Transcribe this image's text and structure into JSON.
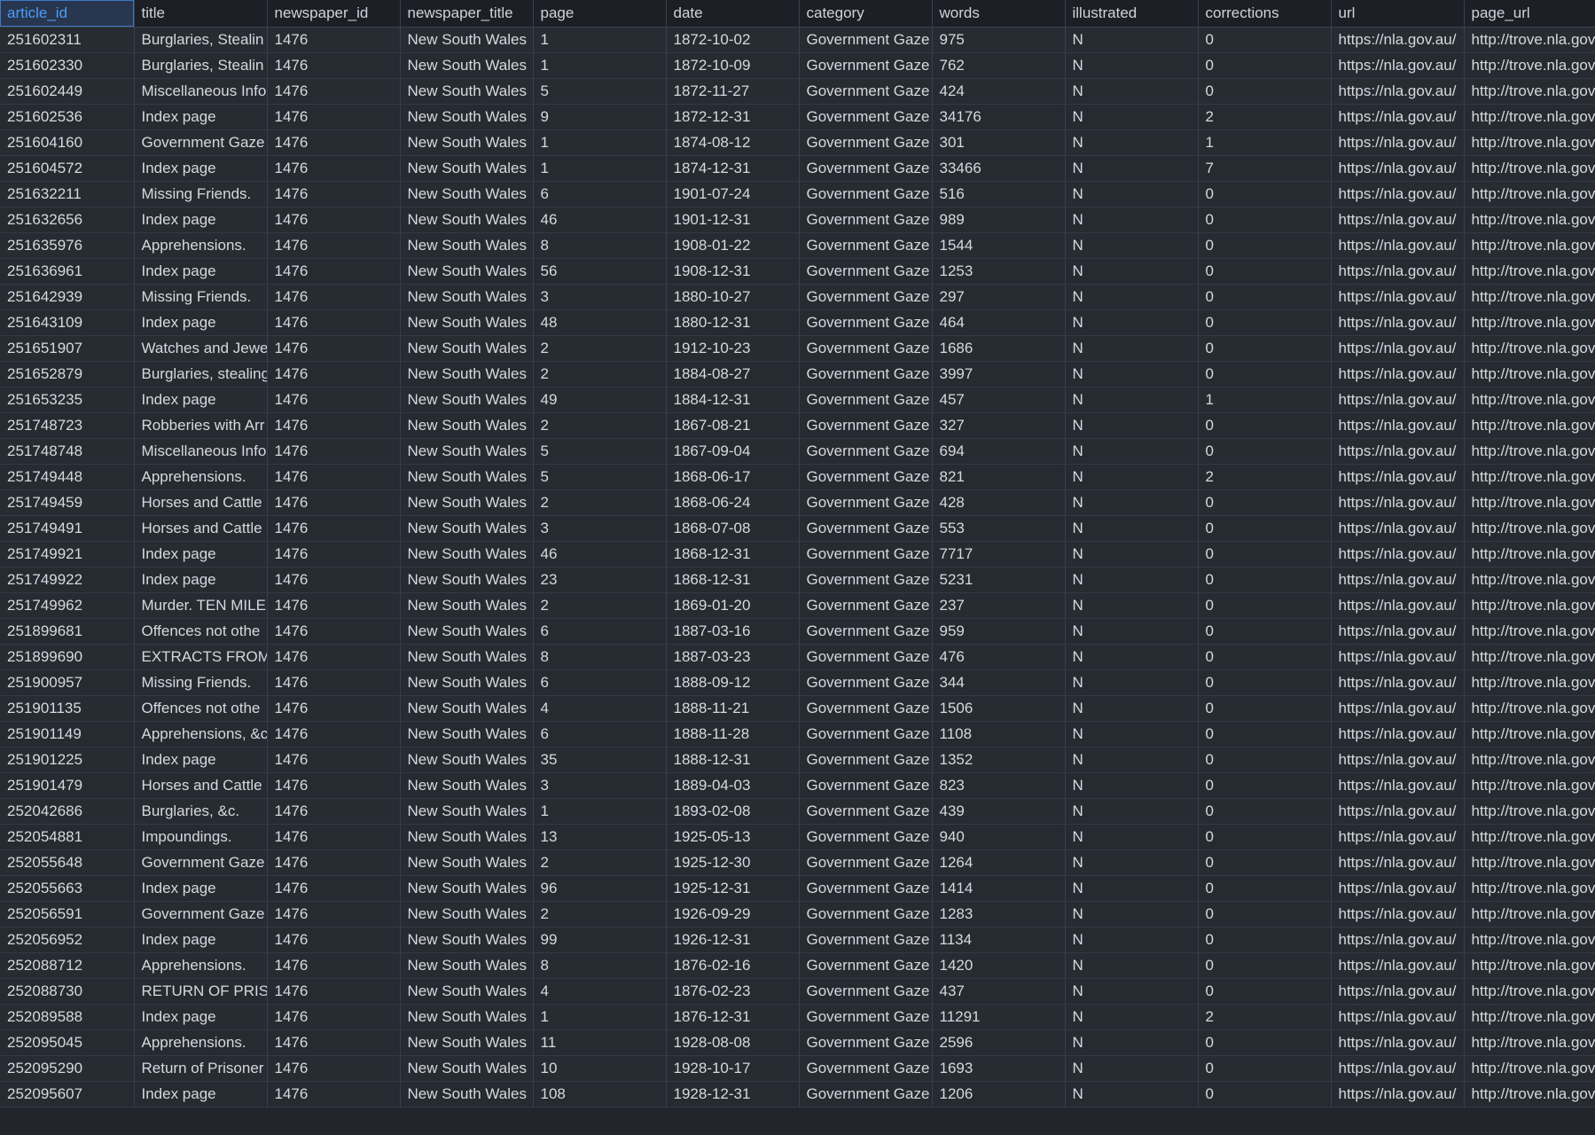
{
  "columns": [
    "article_id",
    "title",
    "newspaper_id",
    "newspaper_title",
    "page",
    "date",
    "category",
    "words",
    "illustrated",
    "corrections",
    "url",
    "page_url"
  ],
  "selected_column": 0,
  "rows": [
    [
      "251602311",
      "Burglaries, Stealin",
      "1476",
      "New South Wales",
      "1",
      "1872-10-02",
      "Government Gaze",
      "975",
      "N",
      "0",
      "https://nla.gov.au/",
      "http://trove.nla.gov"
    ],
    [
      "251602330",
      "Burglaries, Stealin",
      "1476",
      "New South Wales",
      "1",
      "1872-10-09",
      "Government Gaze",
      "762",
      "N",
      "0",
      "https://nla.gov.au/",
      "http://trove.nla.gov"
    ],
    [
      "251602449",
      "Miscellaneous Info",
      "1476",
      "New South Wales",
      "5",
      "1872-11-27",
      "Government Gaze",
      "424",
      "N",
      "0",
      "https://nla.gov.au/",
      "http://trove.nla.gov"
    ],
    [
      "251602536",
      "Index page",
      "1476",
      "New South Wales",
      "9",
      "1872-12-31",
      "Government Gaze",
      "34176",
      "N",
      "2",
      "https://nla.gov.au/",
      "http://trove.nla.gov"
    ],
    [
      "251604160",
      "Government Gaze",
      "1476",
      "New South Wales",
      "1",
      "1874-08-12",
      "Government Gaze",
      "301",
      "N",
      "1",
      "https://nla.gov.au/",
      "http://trove.nla.gov"
    ],
    [
      "251604572",
      "Index page",
      "1476",
      "New South Wales",
      "1",
      "1874-12-31",
      "Government Gaze",
      "33466",
      "N",
      "7",
      "https://nla.gov.au/",
      "http://trove.nla.gov"
    ],
    [
      "251632211",
      "Missing Friends.",
      "1476",
      "New South Wales",
      "6",
      "1901-07-24",
      "Government Gaze",
      "516",
      "N",
      "0",
      "https://nla.gov.au/",
      "http://trove.nla.gov"
    ],
    [
      "251632656",
      "Index page",
      "1476",
      "New South Wales",
      "46",
      "1901-12-31",
      "Government Gaze",
      "989",
      "N",
      "0",
      "https://nla.gov.au/",
      "http://trove.nla.gov"
    ],
    [
      "251635976",
      "Apprehensions.",
      "1476",
      "New South Wales",
      "8",
      "1908-01-22",
      "Government Gaze",
      "1544",
      "N",
      "0",
      "https://nla.gov.au/",
      "http://trove.nla.gov"
    ],
    [
      "251636961",
      "Index page",
      "1476",
      "New South Wales",
      "56",
      "1908-12-31",
      "Government Gaze",
      "1253",
      "N",
      "0",
      "https://nla.gov.au/",
      "http://trove.nla.gov"
    ],
    [
      "251642939",
      "Missing Friends.",
      "1476",
      "New South Wales",
      "3",
      "1880-10-27",
      "Government Gaze",
      "297",
      "N",
      "0",
      "https://nla.gov.au/",
      "http://trove.nla.gov"
    ],
    [
      "251643109",
      "Index page",
      "1476",
      "New South Wales",
      "48",
      "1880-12-31",
      "Government Gaze",
      "464",
      "N",
      "0",
      "https://nla.gov.au/",
      "http://trove.nla.gov"
    ],
    [
      "251651907",
      "Watches and Jewe",
      "1476",
      "New South Wales",
      "2",
      "1912-10-23",
      "Government Gaze",
      "1686",
      "N",
      "0",
      "https://nla.gov.au/",
      "http://trove.nla.gov"
    ],
    [
      "251652879",
      "Burglaries, stealing",
      "1476",
      "New South Wales",
      "2",
      "1884-08-27",
      "Government Gaze",
      "3997",
      "N",
      "0",
      "https://nla.gov.au/",
      "http://trove.nla.gov"
    ],
    [
      "251653235",
      "Index page",
      "1476",
      "New South Wales",
      "49",
      "1884-12-31",
      "Government Gaze",
      "457",
      "N",
      "1",
      "https://nla.gov.au/",
      "http://trove.nla.gov"
    ],
    [
      "251748723",
      "Robberies with Arr",
      "1476",
      "New South Wales",
      "2",
      "1867-08-21",
      "Government Gaze",
      "327",
      "N",
      "0",
      "https://nla.gov.au/",
      "http://trove.nla.gov"
    ],
    [
      "251748748",
      "Miscellaneous Info",
      "1476",
      "New South Wales",
      "5",
      "1867-09-04",
      "Government Gaze",
      "694",
      "N",
      "0",
      "https://nla.gov.au/",
      "http://trove.nla.gov"
    ],
    [
      "251749448",
      "Apprehensions.",
      "1476",
      "New South Wales",
      "5",
      "1868-06-17",
      "Government Gaze",
      "821",
      "N",
      "2",
      "https://nla.gov.au/",
      "http://trove.nla.gov"
    ],
    [
      "251749459",
      "Horses and Cattle",
      "1476",
      "New South Wales",
      "2",
      "1868-06-24",
      "Government Gaze",
      "428",
      "N",
      "0",
      "https://nla.gov.au/",
      "http://trove.nla.gov"
    ],
    [
      "251749491",
      "Horses and Cattle",
      "1476",
      "New South Wales",
      "3",
      "1868-07-08",
      "Government Gaze",
      "553",
      "N",
      "0",
      "https://nla.gov.au/",
      "http://trove.nla.gov"
    ],
    [
      "251749921",
      "Index page",
      "1476",
      "New South Wales",
      "46",
      "1868-12-31",
      "Government Gaze",
      "7717",
      "N",
      "0",
      "https://nla.gov.au/",
      "http://trove.nla.gov"
    ],
    [
      "251749922",
      "Index page",
      "1476",
      "New South Wales",
      "23",
      "1868-12-31",
      "Government Gaze",
      "5231",
      "N",
      "0",
      "https://nla.gov.au/",
      "http://trove.nla.gov"
    ],
    [
      "251749962",
      "Murder. TEN MILE",
      "1476",
      "New South Wales",
      "2",
      "1869-01-20",
      "Government Gaze",
      "237",
      "N",
      "0",
      "https://nla.gov.au/",
      "http://trove.nla.gov"
    ],
    [
      "251899681",
      "Offences not othe",
      "1476",
      "New South Wales",
      "6",
      "1887-03-16",
      "Government Gaze",
      "959",
      "N",
      "0",
      "https://nla.gov.au/",
      "http://trove.nla.gov"
    ],
    [
      "251899690",
      "EXTRACTS FROM",
      "1476",
      "New South Wales",
      "8",
      "1887-03-23",
      "Government Gaze",
      "476",
      "N",
      "0",
      "https://nla.gov.au/",
      "http://trove.nla.gov"
    ],
    [
      "251900957",
      "Missing Friends.",
      "1476",
      "New South Wales",
      "6",
      "1888-09-12",
      "Government Gaze",
      "344",
      "N",
      "0",
      "https://nla.gov.au/",
      "http://trove.nla.gov"
    ],
    [
      "251901135",
      "Offences not othe",
      "1476",
      "New South Wales",
      "4",
      "1888-11-21",
      "Government Gaze",
      "1506",
      "N",
      "0",
      "https://nla.gov.au/",
      "http://trove.nla.gov"
    ],
    [
      "251901149",
      "Apprehensions, &c",
      "1476",
      "New South Wales",
      "6",
      "1888-11-28",
      "Government Gaze",
      "1108",
      "N",
      "0",
      "https://nla.gov.au/",
      "http://trove.nla.gov"
    ],
    [
      "251901225",
      "Index page",
      "1476",
      "New South Wales",
      "35",
      "1888-12-31",
      "Government Gaze",
      "1352",
      "N",
      "0",
      "https://nla.gov.au/",
      "http://trove.nla.gov"
    ],
    [
      "251901479",
      "Horses and Cattle",
      "1476",
      "New South Wales",
      "3",
      "1889-04-03",
      "Government Gaze",
      "823",
      "N",
      "0",
      "https://nla.gov.au/",
      "http://trove.nla.gov"
    ],
    [
      "252042686",
      "Burglaries, &c.",
      "1476",
      "New South Wales",
      "1",
      "1893-02-08",
      "Government Gaze",
      "439",
      "N",
      "0",
      "https://nla.gov.au/",
      "http://trove.nla.gov"
    ],
    [
      "252054881",
      "Impoundings.",
      "1476",
      "New South Wales",
      "13",
      "1925-05-13",
      "Government Gaze",
      "940",
      "N",
      "0",
      "https://nla.gov.au/",
      "http://trove.nla.gov"
    ],
    [
      "252055648",
      "Government Gaze",
      "1476",
      "New South Wales",
      "2",
      "1925-12-30",
      "Government Gaze",
      "1264",
      "N",
      "0",
      "https://nla.gov.au/",
      "http://trove.nla.gov"
    ],
    [
      "252055663",
      "Index page",
      "1476",
      "New South Wales",
      "96",
      "1925-12-31",
      "Government Gaze",
      "1414",
      "N",
      "0",
      "https://nla.gov.au/",
      "http://trove.nla.gov"
    ],
    [
      "252056591",
      "Government Gaze",
      "1476",
      "New South Wales",
      "2",
      "1926-09-29",
      "Government Gaze",
      "1283",
      "N",
      "0",
      "https://nla.gov.au/",
      "http://trove.nla.gov"
    ],
    [
      "252056952",
      "Index page",
      "1476",
      "New South Wales",
      "99",
      "1926-12-31",
      "Government Gaze",
      "1134",
      "N",
      "0",
      "https://nla.gov.au/",
      "http://trove.nla.gov"
    ],
    [
      "252088712",
      "Apprehensions.",
      "1476",
      "New South Wales",
      "8",
      "1876-02-16",
      "Government Gaze",
      "1420",
      "N",
      "0",
      "https://nla.gov.au/",
      "http://trove.nla.gov"
    ],
    [
      "252088730",
      "RETURN OF PRISO",
      "1476",
      "New South Wales",
      "4",
      "1876-02-23",
      "Government Gaze",
      "437",
      "N",
      "0",
      "https://nla.gov.au/",
      "http://trove.nla.gov"
    ],
    [
      "252089588",
      "Index page",
      "1476",
      "New South Wales",
      "1",
      "1876-12-31",
      "Government Gaze",
      "11291",
      "N",
      "2",
      "https://nla.gov.au/",
      "http://trove.nla.gov"
    ],
    [
      "252095045",
      "Apprehensions.",
      "1476",
      "New South Wales",
      "11",
      "1928-08-08",
      "Government Gaze",
      "2596",
      "N",
      "0",
      "https://nla.gov.au/",
      "http://trove.nla.gov"
    ],
    [
      "252095290",
      "Return of Prisoner",
      "1476",
      "New South Wales",
      "10",
      "1928-10-17",
      "Government Gaze",
      "1693",
      "N",
      "0",
      "https://nla.gov.au/",
      "http://trove.nla.gov"
    ],
    [
      "252095607",
      "Index page",
      "1476",
      "New South Wales",
      "108",
      "1928-12-31",
      "Government Gaze",
      "1206",
      "N",
      "0",
      "https://nla.gov.au/",
      "http://trove.nla.gov"
    ]
  ]
}
